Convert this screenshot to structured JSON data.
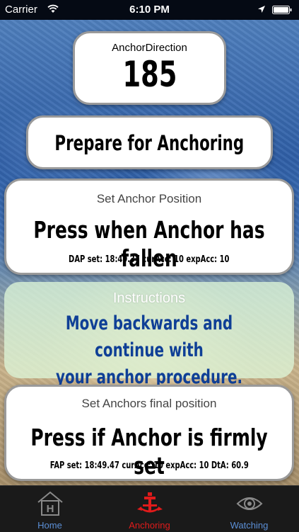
{
  "status_bar": {
    "carrier": "Carrier",
    "time": "6:10 PM"
  },
  "direction": {
    "label": "AnchorDirection",
    "value": "185"
  },
  "prepare": {
    "label": "Prepare for Anchoring"
  },
  "anchor_position": {
    "subtitle": "Set Anchor Position",
    "button_text": "Press when Anchor has fallen",
    "info": "DAP set: 18:49.37 curAcc: 10 expAcc: 10"
  },
  "instructions": {
    "title": "Instructions",
    "line1": "Move backwards and continue with",
    "line2": "your anchor procedure."
  },
  "final_position": {
    "subtitle": "Set Anchors final position",
    "button_text": "Press if Anchor is firmly set",
    "info": "FAP set: 18:49.47 curAcc: 10 expAcc: 10 DtA: 60.9"
  },
  "tabs": [
    {
      "label": "Home",
      "icon": "home-icon",
      "selected": false
    },
    {
      "label": "Anchoring",
      "icon": "anchor-icon",
      "selected": true
    },
    {
      "label": "Watching",
      "icon": "eye-icon",
      "selected": false
    }
  ],
  "colors": {
    "tab_default": "#5b8fd6",
    "tab_selected": "#e01b1b",
    "instruction_text": "#0f3f96"
  }
}
